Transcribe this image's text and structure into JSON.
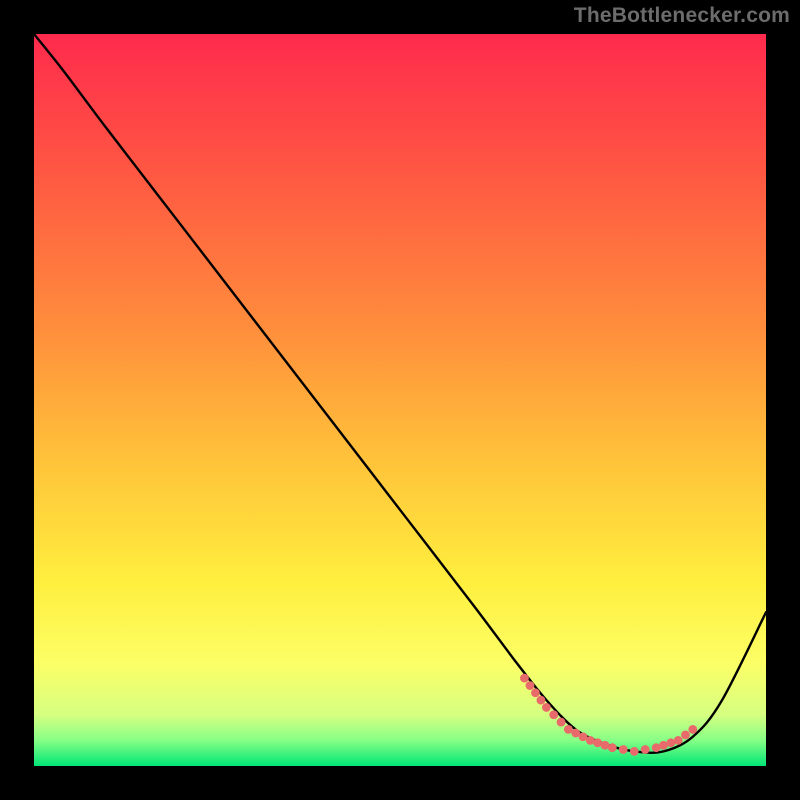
{
  "watermark": "TheBottlenecker.com",
  "chart_data": {
    "type": "line",
    "title": "",
    "xlabel": "",
    "ylabel": "",
    "xlim": [
      0,
      100
    ],
    "ylim": [
      0,
      100
    ],
    "gradient": {
      "stops": [
        {
          "offset": 0.0,
          "color": "#ff2a4d"
        },
        {
          "offset": 0.2,
          "color": "#ff5a42"
        },
        {
          "offset": 0.4,
          "color": "#ff8d3c"
        },
        {
          "offset": 0.58,
          "color": "#ffc23a"
        },
        {
          "offset": 0.75,
          "color": "#ffef3e"
        },
        {
          "offset": 0.86,
          "color": "#fcff66"
        },
        {
          "offset": 0.93,
          "color": "#d6ff81"
        },
        {
          "offset": 0.965,
          "color": "#86ff86"
        },
        {
          "offset": 1.0,
          "color": "#00e676"
        }
      ]
    },
    "main_curve": {
      "description": "Bottleneck curve; y=100 at x≈0, falls nearly linearly to a flat minimum around x≈75–90, then rises toward x=100.",
      "x": [
        0,
        4,
        10,
        20,
        30,
        40,
        50,
        60,
        66,
        70,
        74,
        78,
        82,
        86,
        90,
        94,
        100
      ],
      "y": [
        100,
        95,
        87,
        74,
        61,
        48,
        35,
        22,
        14,
        9,
        5,
        3,
        2,
        2,
        4,
        9,
        21
      ]
    },
    "highlight_segment": {
      "description": "Pink dotted overlay near the valley bottom.",
      "color": "#e96a6a",
      "x": [
        67,
        70,
        73,
        76,
        79,
        82,
        85,
        88,
        90
      ],
      "y": [
        12,
        8,
        5,
        3.5,
        2.5,
        2,
        2.5,
        3.5,
        5
      ]
    }
  }
}
